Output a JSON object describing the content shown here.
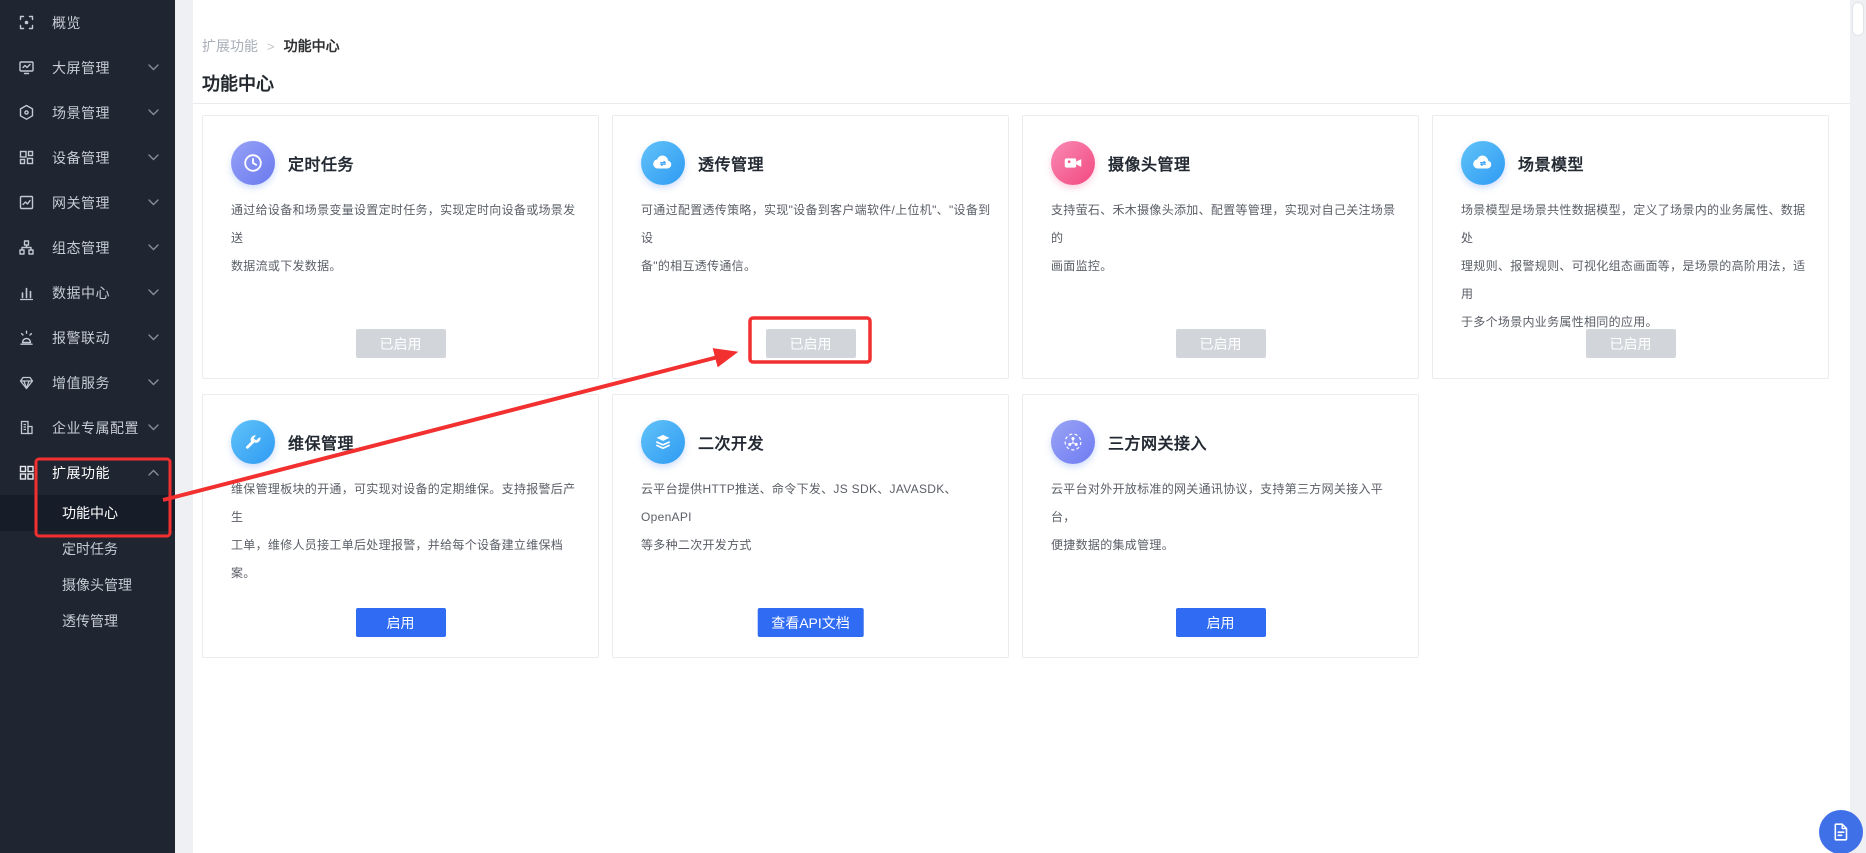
{
  "sidebar": {
    "items": [
      {
        "label": "概览",
        "icon": "overview-icon",
        "has_chevron": false
      },
      {
        "label": "大屏管理",
        "icon": "screen-icon",
        "has_chevron": true
      },
      {
        "label": "场景管理",
        "icon": "scene-icon",
        "has_chevron": true
      },
      {
        "label": "设备管理",
        "icon": "device-icon",
        "has_chevron": true
      },
      {
        "label": "网关管理",
        "icon": "gateway-icon",
        "has_chevron": true
      },
      {
        "label": "组态管理",
        "icon": "topology-icon",
        "has_chevron": true
      },
      {
        "label": "数据中心",
        "icon": "bar-chart-icon",
        "has_chevron": true
      },
      {
        "label": "报警联动",
        "icon": "alarm-icon",
        "has_chevron": true
      },
      {
        "label": "增值服务",
        "icon": "gem-icon",
        "has_chevron": true
      },
      {
        "label": "企业专属配置",
        "icon": "building-icon",
        "has_chevron": true
      },
      {
        "label": "扩展功能",
        "icon": "grid-icon",
        "has_chevron": true,
        "expanded": true
      }
    ],
    "submenu": [
      {
        "label": "功能中心",
        "active": true
      },
      {
        "label": "定时任务",
        "active": false
      },
      {
        "label": "摄像头管理",
        "active": false
      },
      {
        "label": "透传管理",
        "active": false
      }
    ]
  },
  "breadcrumb": {
    "parent": "扩展功能",
    "separator": ">",
    "current": "功能中心"
  },
  "page_title": "功能中心",
  "cards": [
    {
      "title": "定时任务",
      "icon": "clock-icon",
      "icon_color": "indigo",
      "desc": "通过给设备和场景变量设置定时任务，实现定时向设备或场景发送\n数据流或下发数据。",
      "button": {
        "label": "已启用",
        "style": "gray"
      }
    },
    {
      "title": "透传管理",
      "icon": "cloud-sync-icon",
      "icon_color": "blue",
      "desc": "可通过配置透传策略，实现\"设备到客户端软件/上位机\"、\"设备到设\n备\"的相互透传通信。",
      "button": {
        "label": "已启用",
        "style": "gray"
      },
      "annotated": true
    },
    {
      "title": "摄像头管理",
      "icon": "camera-icon",
      "icon_color": "pink",
      "desc": "支持萤石、禾木摄像头添加、配置等管理，实现对自己关注场景的\n画面监控。",
      "button": {
        "label": "已启用",
        "style": "gray"
      }
    },
    {
      "title": "场景模型",
      "icon": "cloud-sync-icon",
      "icon_color": "blue",
      "desc": "场景模型是场景共性数据模型，定义了场景内的业务属性、数据处\n理规则、报警规则、可视化组态画面等，是场景的高阶用法，适用\n于多个场景内业务属性相同的应用。",
      "button": {
        "label": "已启用",
        "style": "gray"
      }
    },
    {
      "title": "维保管理",
      "icon": "wrench-icon",
      "icon_color": "blue",
      "desc": "维保管理板块的开通，可实现对设备的定期维保。支持报警后产生\n工单，维修人员接工单后处理报警，并给每个设备建立维保档案。",
      "button": {
        "label": "启用",
        "style": "blue"
      }
    },
    {
      "title": "二次开发",
      "icon": "layers-icon",
      "icon_color": "blue",
      "desc": "云平台提供HTTP推送、命令下发、JS SDK、JAVASDK、OpenAPI\n等多种二次开发方式",
      "button": {
        "label": "查看API文档",
        "style": "blue"
      }
    },
    {
      "title": "三方网关接入",
      "icon": "network-icon",
      "icon_color": "purple",
      "desc": "云平台对外开放标准的网关通讯协议，支持第三方网关接入平台，\n便捷数据的集成管理。",
      "button": {
        "label": "启用",
        "style": "blue"
      }
    }
  ],
  "float_button": {
    "icon": "document-icon"
  },
  "colors": {
    "sidebar_bg": "#1f2531",
    "sidebar_active_bg": "#161c28",
    "primary_blue": "#2f6bf3",
    "disabled_gray": "#d2d5da",
    "annotation_red": "#f23030",
    "icon_indigo": [
      "#97a2f7",
      "#6a79ee"
    ],
    "icon_blue": [
      "#62c3f9",
      "#2e9af2"
    ],
    "icon_pink": [
      "#f98ab4",
      "#f2487f"
    ],
    "icon_purple": [
      "#9aa4f5",
      "#6e7bf2"
    ],
    "float_button_blue": "#4070e8"
  }
}
